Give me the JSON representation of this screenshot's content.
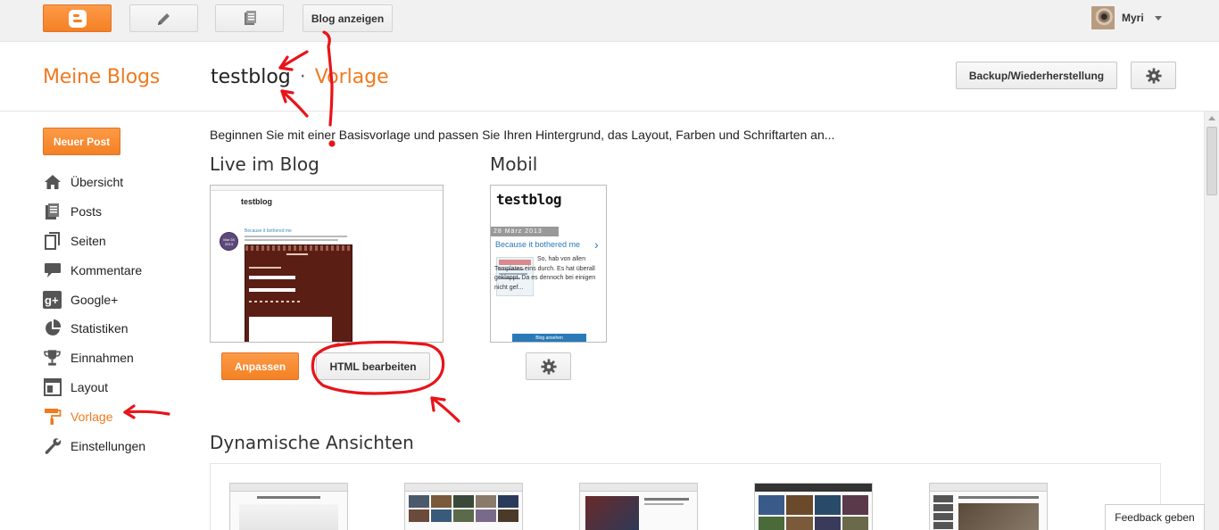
{
  "topbar": {
    "view_blog": "Blog anzeigen",
    "user_name": "Myri"
  },
  "header": {
    "brand": "Meine Blogs",
    "blog_name": "testblog",
    "separator": "·",
    "page_name": "Vorlage",
    "backup_button": "Backup/Wiederherstellung"
  },
  "sidebar": {
    "new_post": "Neuer Post",
    "items": [
      {
        "label": "Übersicht",
        "icon": "home-icon"
      },
      {
        "label": "Posts",
        "icon": "posts-icon"
      },
      {
        "label": "Seiten",
        "icon": "pages-icon"
      },
      {
        "label": "Kommentare",
        "icon": "comment-icon"
      },
      {
        "label": "Google+",
        "icon": "google-plus-icon"
      },
      {
        "label": "Statistiken",
        "icon": "pie-chart-icon"
      },
      {
        "label": "Einnahmen",
        "icon": "trophy-icon"
      },
      {
        "label": "Layout",
        "icon": "layout-icon"
      },
      {
        "label": "Vorlage",
        "icon": "paint-roller-icon",
        "active": true
      },
      {
        "label": "Einstellungen",
        "icon": "wrench-icon"
      }
    ]
  },
  "main": {
    "intro": "Beginnen Sie mit einer Basisvorlage und passen Sie Ihren Hintergrund, das Layout, Farben und Schriftarten an...",
    "live": {
      "title": "Live im Blog",
      "preview_blog_title": "testblog",
      "preview_post_title": "Because it bothered me",
      "preview_date_line": "Mar 28 2013"
    },
    "mobile": {
      "title": "Mobil",
      "preview_blog_title": "testblog",
      "preview_date": "28 März 2013",
      "preview_post_title": "Because it bothered me",
      "preview_text": "So, hab von allen Templates eins durch. Es hat überall geklappt. Da es dennoch bei einigen nicht gef...",
      "preview_button": "Blog ansehen"
    },
    "customize_button": "Anpassen",
    "edit_html_button": "HTML bearbeiten",
    "dynamic": {
      "title": "Dynamische Ansichten"
    }
  },
  "feedback": "Feedback geben",
  "colors": {
    "accent": "#f07a1f",
    "annotation": "#e8141a"
  }
}
